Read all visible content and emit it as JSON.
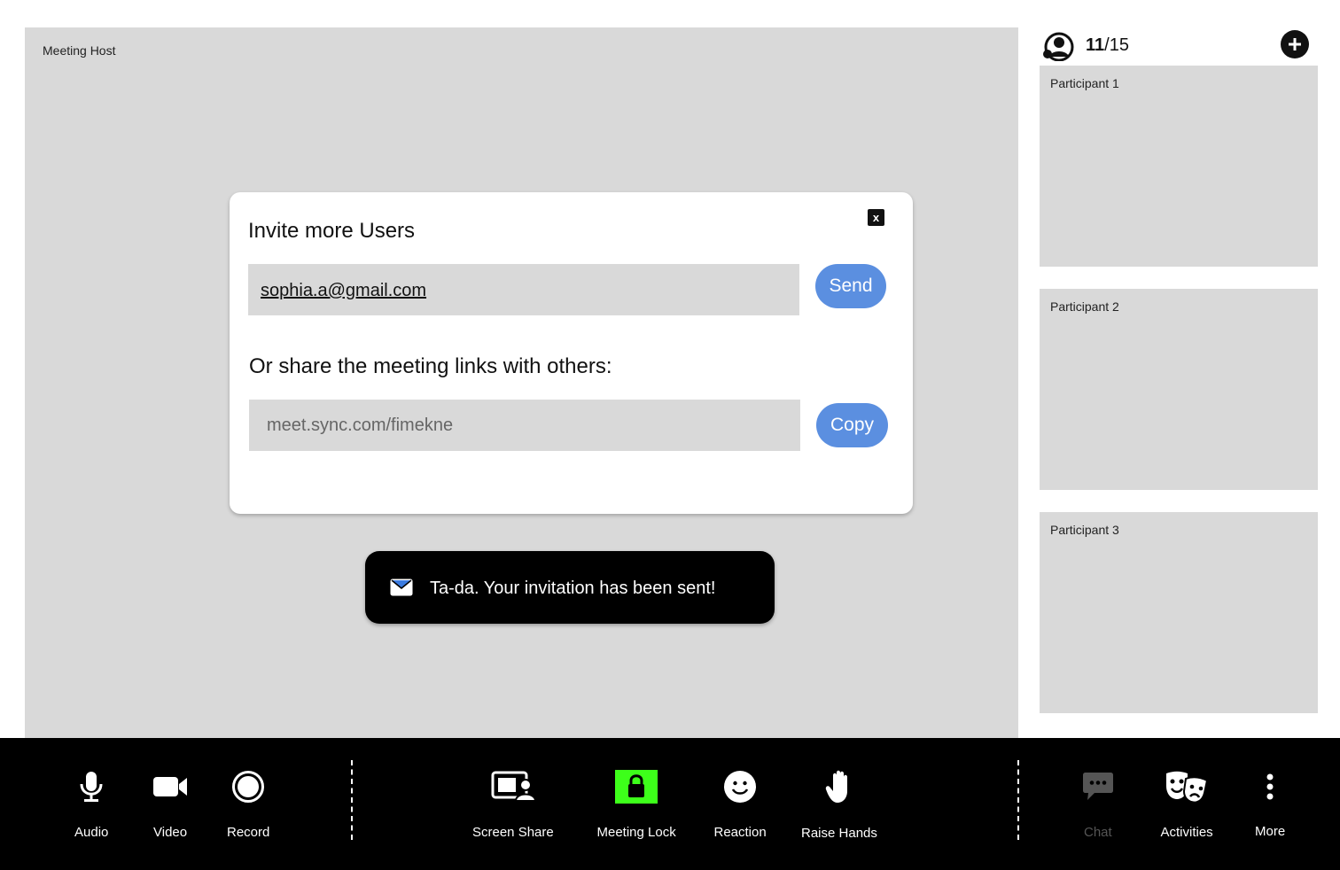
{
  "main": {
    "host_label": "Meeting Host"
  },
  "participants_panel": {
    "count_current": "11",
    "count_total": "/15",
    "tiles": [
      {
        "label": "Participant 1"
      },
      {
        "label": "Participant 2"
      },
      {
        "label": "Participant 3"
      }
    ]
  },
  "invite_modal": {
    "title": "Invite more Users",
    "close_label": "x",
    "email_value": "sophia.a@gmail.com",
    "send_label": "Send",
    "share_text": "Or share the meeting links with others:",
    "link_value": "meet.sync.com/fimekne",
    "copy_label": "Copy"
  },
  "toast": {
    "message": "Ta-da. Your invitation has been sent!"
  },
  "toolbar": {
    "audio": "Audio",
    "video": "Video",
    "record": "Record",
    "screen_share": "Screen Share",
    "meeting_lock": "Meeting Lock",
    "reaction": "Reaction",
    "raise_hands": "Raise Hands",
    "chat": "Chat",
    "activities": "Activities",
    "more": "More"
  },
  "colors": {
    "accent_button": "#5b8fe0",
    "meeting_lock_active": "#3dff1a",
    "video_placeholder": "#d9d9d9"
  }
}
